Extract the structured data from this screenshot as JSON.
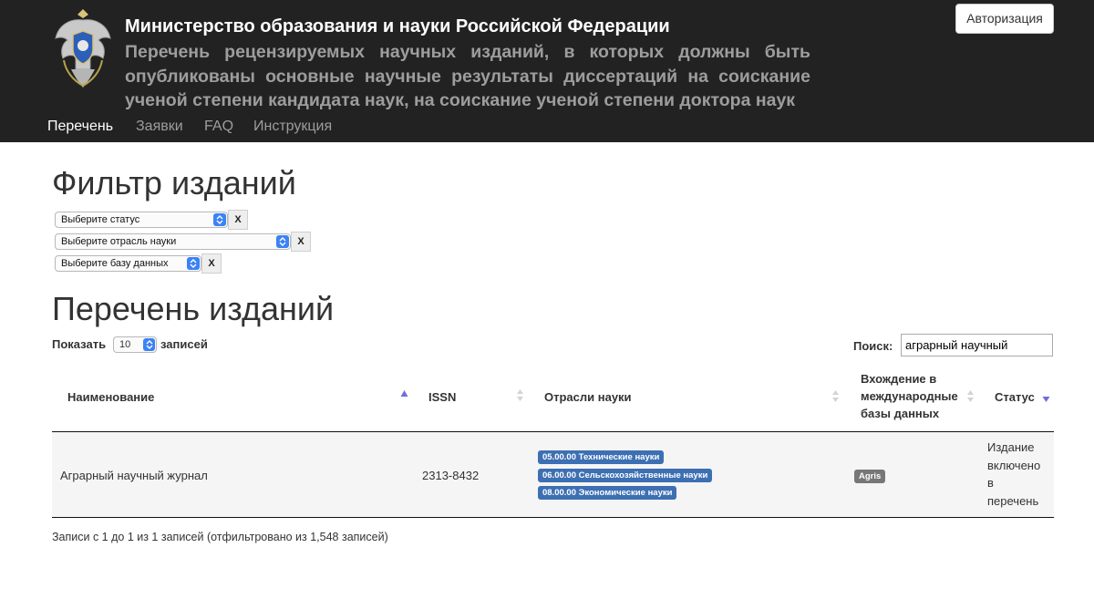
{
  "header": {
    "title": "Министерство образования и науки Российской Федерации",
    "subtitle": "Перечень рецензируемых научных изданий, в которых должны быть опубликованы основные научные результаты диссертаций на соискание ученой степени кандидата наук, на соискание ученой степени доктора наук",
    "login_label": "Авторизация",
    "emblem_icon": "coat-of-arms-icon"
  },
  "nav": {
    "items": [
      {
        "label": "Перечень",
        "active": true
      },
      {
        "label": "Заявки",
        "active": false
      },
      {
        "label": "FAQ",
        "active": false
      },
      {
        "label": "Инструкция",
        "active": false
      }
    ]
  },
  "filter": {
    "title": "Фильтр изданий",
    "status_select": "Выберите статус",
    "branch_select": "Выберите отрасль науки",
    "db_select": "Выберите базу данных",
    "clear_label": "X"
  },
  "list": {
    "title": "Перечень изданий",
    "show_label": "Показать",
    "show_value": "10",
    "records_label": "записей",
    "search_label": "Поиск:",
    "search_value": "аграрный научный"
  },
  "table": {
    "columns": {
      "name": "Наименование",
      "issn": "ISSN",
      "branches": "Отрасли науки",
      "db_line1": "Вхождение в",
      "db_line2": "международные",
      "db_line3": "базы данных",
      "status": "Статус"
    },
    "rows": [
      {
        "name": "Аграрный научный журнал",
        "issn": "2313-8432",
        "branches": [
          "05.00.00 Технические науки",
          "06.00.00 Сельскохозяйственные науки",
          "08.00.00 Экономические науки"
        ],
        "db": "Agris",
        "status_lines": [
          "Издание",
          "включено",
          "в",
          "перечень"
        ]
      }
    ],
    "info": "Записи с 1 до 1 из 1 записей (отфильтровано из 1,548 записей)"
  },
  "colors": {
    "header_bg": "#222222",
    "badge_blue": "#3d6fb3",
    "badge_grey": "#777777",
    "sort_active": "#6f6fd6"
  }
}
